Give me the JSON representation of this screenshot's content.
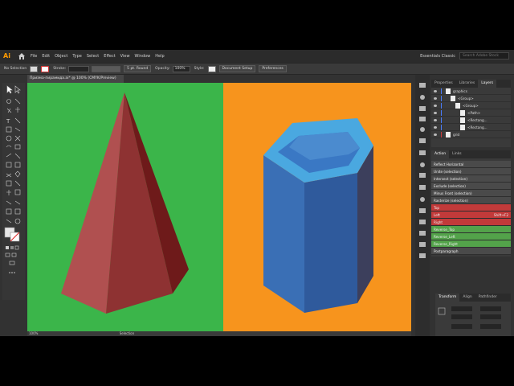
{
  "menu": {
    "logo": "Ai",
    "items": [
      "File",
      "Edit",
      "Object",
      "Type",
      "Select",
      "Effect",
      "View",
      "Window",
      "Help"
    ],
    "workspace": "Essentials Classic",
    "search_placeholder": "Search Adobe Stock"
  },
  "control": {
    "selection": "No Selection",
    "stroke_label": "Stroke:",
    "brush": "5 pt. Round",
    "opacity_label": "Opacity:",
    "opacity": "100%",
    "style_label": "Style:",
    "doc_setup": "Document Setup",
    "preferences": "Preferences"
  },
  "document_tab": "Призма-пирамида.ai* @ 100% (CMYK/Preview)",
  "status": {
    "zoom": "100%",
    "tool": "Selection"
  },
  "layers_panel": {
    "tabs": [
      "Properties",
      "Libraries",
      "Layers"
    ],
    "rows": [
      {
        "name": "graphics",
        "color": "#4a7cff"
      },
      {
        "name": "<Group>",
        "color": "#4a7cff"
      },
      {
        "name": "<Group>",
        "color": "#4a7cff"
      },
      {
        "name": "<Path>",
        "color": "#4a7cff"
      },
      {
        "name": "<Rectang...",
        "color": "#4a7cff"
      },
      {
        "name": "<Rectang...",
        "color": "#4a7cff"
      },
      {
        "name": "grid",
        "color": "#cc3b3b"
      }
    ]
  },
  "actions_panel": {
    "tabs": [
      "Action",
      "Links"
    ],
    "rows": [
      {
        "label": "Reflect Horizontal",
        "bg": "#4a4a4a",
        "key": ""
      },
      {
        "label": "Unite (selection)",
        "bg": "#4a4a4a",
        "key": ""
      },
      {
        "label": "Intersect (selection)",
        "bg": "#4a4a4a",
        "key": ""
      },
      {
        "label": "Exclude (selection)",
        "bg": "#4a4a4a",
        "key": ""
      },
      {
        "label": "Minus Front (selection)",
        "bg": "#4a4a4a",
        "key": ""
      },
      {
        "label": "Rasterize (selection)",
        "bg": "#4a4a4a",
        "key": ""
      },
      {
        "label": "Top",
        "bg": "#c23a3a",
        "key": ""
      },
      {
        "label": "Left",
        "bg": "#c23a3a",
        "key": "Shift+F2"
      },
      {
        "label": "Right",
        "bg": "#c23a3a",
        "key": ""
      },
      {
        "label": "Reverse_Top",
        "bg": "#53a34a",
        "key": ""
      },
      {
        "label": "Reverse_Left",
        "bg": "#53a34a",
        "key": ""
      },
      {
        "label": "Reverse_Right",
        "bg": "#53a34a",
        "key": ""
      },
      {
        "label": "Postparagraph",
        "bg": "#4a4a4a",
        "key": ""
      }
    ]
  },
  "transform_panel": {
    "tabs": [
      "Transform",
      "Align",
      "Pathfinder"
    ]
  },
  "colors": {
    "canvas_left": "#3bb54a",
    "canvas_right": "#f7941d",
    "accent": "#ff9a00"
  }
}
